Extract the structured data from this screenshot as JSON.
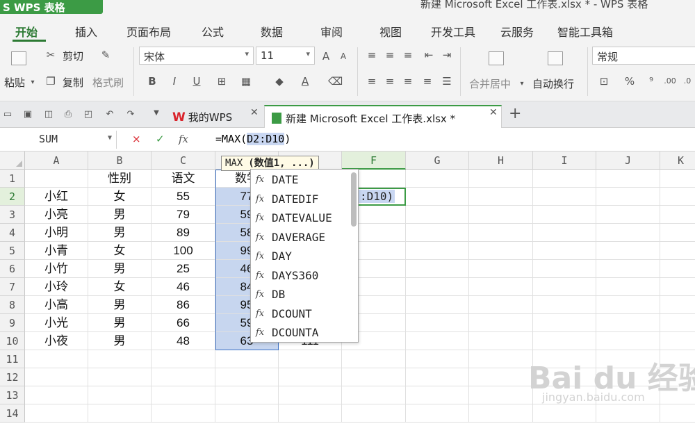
{
  "app": {
    "badge": "S WPS 表格",
    "doc_title": "新建 Microsoft Excel 工作表.xlsx * - WPS 表格"
  },
  "ribbon_tabs": [
    "开始",
    "插入",
    "页面布局",
    "公式",
    "数据",
    "审阅",
    "视图",
    "开发工具",
    "云服务",
    "智能工具箱"
  ],
  "ribbon": {
    "paste": "粘贴",
    "cut": "剪切",
    "copy": "复制",
    "format_painter": "格式刷",
    "font_name": "宋体",
    "font_size": "11",
    "merge_center": "合并居中",
    "wrap_text": "自动换行",
    "number_format": "常规",
    "bold": "B",
    "italic": "I",
    "underline": "U"
  },
  "doc_tabs": [
    {
      "label": "我的WPS",
      "logo": "W"
    },
    {
      "label": "新建 Microsoft Excel 工作表.xlsx *"
    }
  ],
  "formula_bar": {
    "name_box": "SUM",
    "cancel": "×",
    "enter": "✓",
    "fx": "fx",
    "formula_prefix": "=MAX(",
    "formula_ref": "D2:D10",
    "formula_suffix": ")"
  },
  "columns": [
    "A",
    "B",
    "C",
    "D",
    "E",
    "F",
    "G",
    "H",
    "I",
    "J",
    "K"
  ],
  "rows": [
    "1",
    "2",
    "3",
    "4",
    "5",
    "6",
    "7",
    "8",
    "9",
    "10",
    "11",
    "12",
    "13",
    "14"
  ],
  "sheet": {
    "header": [
      "",
      "性别",
      "语文",
      "数学"
    ],
    "data": [
      [
        "小红",
        "女",
        "55",
        "77"
      ],
      [
        "小亮",
        "男",
        "79",
        "59"
      ],
      [
        "小明",
        "男",
        "89",
        "58"
      ],
      [
        "小青",
        "女",
        "100",
        "99"
      ],
      [
        "小竹",
        "男",
        "25",
        "46"
      ],
      [
        "小玲",
        "女",
        "46",
        "84"
      ],
      [
        "小高",
        "男",
        "86",
        "95"
      ],
      [
        "小光",
        "男",
        "66",
        "59"
      ],
      [
        "小夜",
        "男",
        "48",
        "63"
      ]
    ],
    "e10": "111",
    "active_cell_text": ":D10)",
    "active_cell_ref": "F2"
  },
  "arg_tooltip": {
    "func": "MAX",
    "arg": "(数值1, ...)"
  },
  "autocomplete": [
    "DATE",
    "DATEDIF",
    "DATEVALUE",
    "DAVERAGE",
    "DAY",
    "DAYS360",
    "DB",
    "DCOUNT",
    "DCOUNTA"
  ],
  "watermark": {
    "text": "Bai du 经验",
    "url": "jingyan.baidu.com"
  },
  "colors": {
    "accent": "#3c9b45",
    "selection": "#c7d6ef"
  }
}
